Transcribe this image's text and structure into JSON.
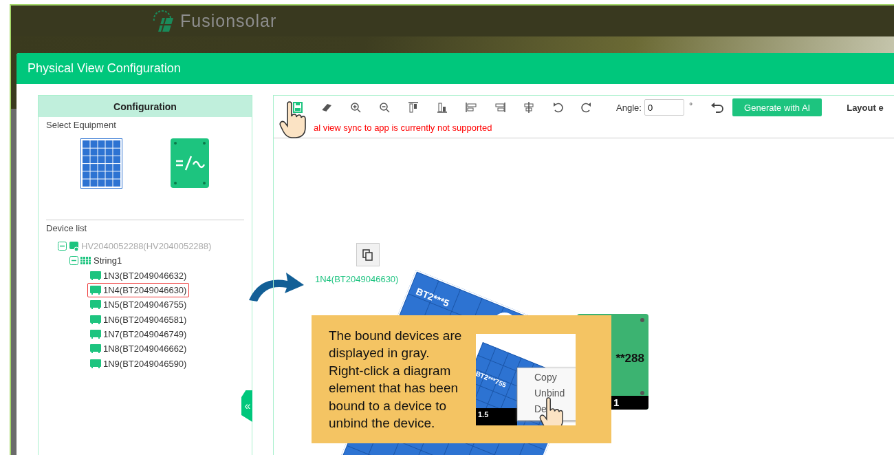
{
  "app_header": {
    "brand": "Fusionsolar"
  },
  "dialog": {
    "title": "Physical View Configuration"
  },
  "config_panel": {
    "title": "Configuration",
    "select_equipment_label": "Select Equipment",
    "device_list_label": "Device list",
    "collapse_handle": "«"
  },
  "device_tree": [
    {
      "label": "HV2040052288(HV2040052288)",
      "kind": "inverter",
      "bound": true,
      "highlighted": false,
      "expanded": true,
      "children": [
        {
          "label": "String1",
          "kind": "string",
          "bound": false,
          "highlighted": false,
          "expanded": true,
          "children": [
            {
              "label": "1N3(BT2049046632)",
              "kind": "module",
              "bound": false,
              "highlighted": false
            },
            {
              "label": "1N4(BT2049046630)",
              "kind": "module",
              "bound": false,
              "highlighted": true
            },
            {
              "label": "1N5(BT2049046755)",
              "kind": "module",
              "bound": false,
              "highlighted": false
            },
            {
              "label": "1N6(BT2049046581)",
              "kind": "module",
              "bound": false,
              "highlighted": false
            },
            {
              "label": "1N7(BT2049046749)",
              "kind": "module",
              "bound": false,
              "highlighted": false
            },
            {
              "label": "1N8(BT2049046662)",
              "kind": "module",
              "bound": false,
              "highlighted": false
            },
            {
              "label": "1N9(BT2049046590)",
              "kind": "module",
              "bound": false,
              "highlighted": false
            }
          ]
        }
      ]
    }
  ],
  "toolbar": {
    "angle_label": "Angle:",
    "angle_value": "0",
    "degree_sign": "°",
    "generate_button": "Generate with AI",
    "layout_label": "Layout e",
    "warning": "al view sync to app is currently not supported"
  },
  "canvas": {
    "selected_device_label": "1N4(BT2049046630)",
    "panel_label": "BT2***5",
    "inverter_label": "**288",
    "inverter_index": "1"
  },
  "callout": {
    "text": "The bound devices are displayed in gray. Right-click a diagram element that has been bound to a device to unbind the device.",
    "inset": {
      "panel_label": "BT2***755",
      "panel_index": "1.5",
      "menu": [
        "Copy",
        "Unbind",
        "De"
      ]
    }
  }
}
